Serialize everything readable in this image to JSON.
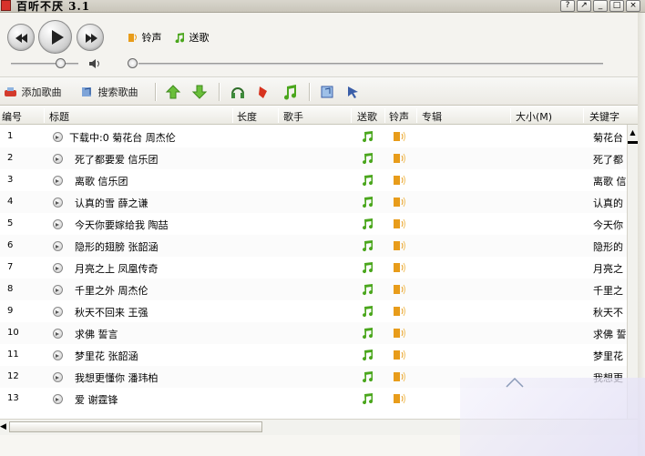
{
  "window": {
    "title": "百听不厌 3.1"
  },
  "player": {
    "ringtone_label": "铃声",
    "send_song_label": "送歌",
    "volume_level": 0.55,
    "progress_level": 0.0
  },
  "toolbar": {
    "add_song_label": "添加歌曲",
    "search_song_label": "搜索歌曲"
  },
  "table": {
    "headers": {
      "no": "编号",
      "title": "标题",
      "length": "长度",
      "singer": "歌手",
      "send": "送歌",
      "ring": "铃声",
      "album": "专辑",
      "size": "大小(M)",
      "keyword": "关键字"
    },
    "rows": [
      {
        "no": "1",
        "title": "下载中:0 菊花台 周杰伦",
        "keyword": "菊花台"
      },
      {
        "no": "2",
        "title": "死了都要爱 信乐团",
        "keyword": "死了都"
      },
      {
        "no": "3",
        "title": "离歌 信乐团",
        "keyword": "离歌 信"
      },
      {
        "no": "4",
        "title": "认真的雪 薛之谦",
        "keyword": "认真的"
      },
      {
        "no": "5",
        "title": "今天你要嫁给我 陶喆",
        "keyword": "今天你"
      },
      {
        "no": "6",
        "title": "隐形的翅膀 张韶涵",
        "keyword": "隐形的"
      },
      {
        "no": "7",
        "title": "月亮之上 凤凰传奇",
        "keyword": "月亮之"
      },
      {
        "no": "8",
        "title": "千里之外 周杰伦",
        "keyword": "千里之"
      },
      {
        "no": "9",
        "title": "秋天不回来 王强",
        "keyword": "秋天不"
      },
      {
        "no": "10",
        "title": "求佛 誓言",
        "keyword": "求佛 誓"
      },
      {
        "no": "11",
        "title": "梦里花 张韶涵",
        "keyword": "梦里花"
      },
      {
        "no": "12",
        "title": "我想更懂你 潘玮柏",
        "keyword": "我想更"
      },
      {
        "no": "13",
        "title": "爱 谢霆锋",
        "keyword": ""
      }
    ]
  },
  "icons": {
    "send": "music-note-icon",
    "ring": "ringtone-icon"
  },
  "colors": {
    "note_green": "#4aa61c",
    "bell_orange": "#e89c1a",
    "accent_blue": "#3a5ea8"
  }
}
